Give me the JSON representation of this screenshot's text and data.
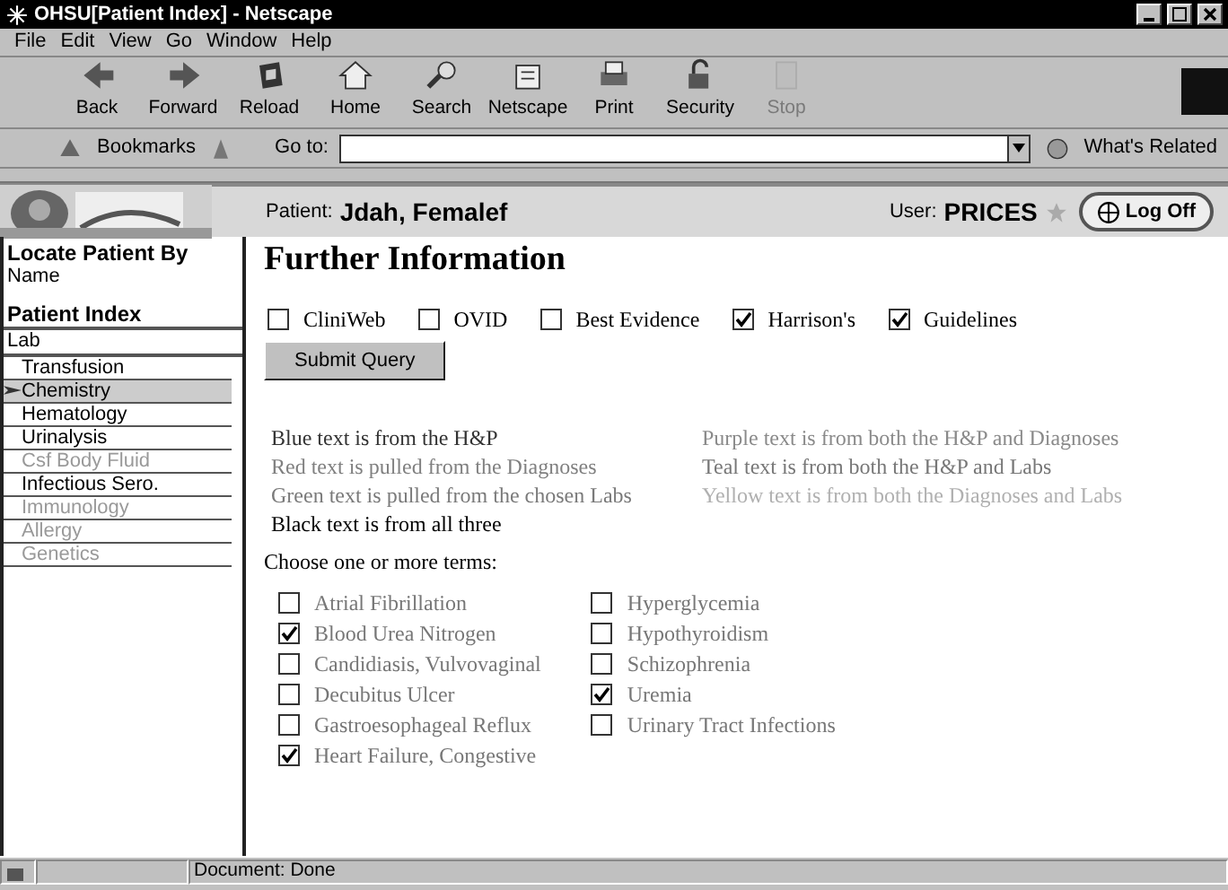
{
  "window": {
    "title": "OHSU[Patient Index] - Netscape"
  },
  "menu": [
    "File",
    "Edit",
    "View",
    "Go",
    "Window",
    "Help"
  ],
  "toolbar": [
    {
      "label": "Back",
      "disabled": false
    },
    {
      "label": "Forward",
      "disabled": false
    },
    {
      "label": "Reload",
      "disabled": false
    },
    {
      "label": "Home",
      "disabled": false
    },
    {
      "label": "Search",
      "disabled": false
    },
    {
      "label": "Netscape",
      "disabled": false
    },
    {
      "label": "Print",
      "disabled": false
    },
    {
      "label": "Security",
      "disabled": false
    },
    {
      "label": "Stop",
      "disabled": true
    }
  ],
  "location_bar": {
    "bookmarks": "Bookmarks",
    "goto_label": "Go to:",
    "related": "What's Related"
  },
  "header": {
    "patient_label": "Patient:",
    "patient_name": "Jdah, Femalef",
    "user_label": "User:",
    "user_name": "PRICES",
    "logoff": "Log Off"
  },
  "sidebar": {
    "locate_heading": "Locate Patient By",
    "locate_link": "Name",
    "index_heading": "Patient Index",
    "section": "Lab",
    "items": [
      {
        "label": "Transfusion",
        "selected": false,
        "disabled": false
      },
      {
        "label": "Chemistry",
        "selected": true,
        "disabled": false
      },
      {
        "label": "Hematology",
        "selected": false,
        "disabled": false
      },
      {
        "label": "Urinalysis",
        "selected": false,
        "disabled": false
      },
      {
        "label": "Csf Body Fluid",
        "selected": false,
        "disabled": true
      },
      {
        "label": "Infectious Sero.",
        "selected": false,
        "disabled": false
      },
      {
        "label": "Immunology",
        "selected": false,
        "disabled": true
      },
      {
        "label": "Allergy",
        "selected": false,
        "disabled": true
      },
      {
        "label": "Genetics",
        "selected": false,
        "disabled": true
      }
    ]
  },
  "content": {
    "title": "Further Information",
    "sources": [
      {
        "label": "CliniWeb",
        "checked": false
      },
      {
        "label": "OVID",
        "checked": false
      },
      {
        "label": "Best Evidence",
        "checked": false
      },
      {
        "label": "Harrison's",
        "checked": true
      },
      {
        "label": "Guidelines",
        "checked": true
      }
    ],
    "submit": "Submit Query",
    "legend": [
      {
        "text": "Blue text is from the H&P",
        "color": "#333333"
      },
      {
        "text": "Purple text is from both the H&P and Diagnoses",
        "color": "#8a8a8a"
      },
      {
        "text": "Red text is pulled from the Diagnoses",
        "color": "#808080"
      },
      {
        "text": "Teal text is from both the H&P and Labs",
        "color": "#777777"
      },
      {
        "text": "Green text is pulled from the chosen Labs",
        "color": "#7a7a7a"
      },
      {
        "text": "Yellow text is from both the Diagnoses and Labs",
        "color": "#b0b0b0"
      },
      {
        "text": "Black text is from all three",
        "color": "#000000"
      }
    ],
    "terms_prompt": "Choose one or more terms:",
    "terms": [
      [
        {
          "label": "Atrial Fibrillation",
          "checked": false
        },
        {
          "label": "Blood Urea Nitrogen",
          "checked": true
        },
        {
          "label": "Candidiasis, Vulvovaginal",
          "checked": false
        },
        {
          "label": "Decubitus Ulcer",
          "checked": false
        },
        {
          "label": "Gastroesophageal Reflux",
          "checked": false
        },
        {
          "label": "Heart Failure, Congestive",
          "checked": true
        }
      ],
      [
        {
          "label": "Hyperglycemia",
          "checked": false
        },
        {
          "label": "Hypothyroidism",
          "checked": false
        },
        {
          "label": "Schizophrenia",
          "checked": false
        },
        {
          "label": "Uremia",
          "checked": true
        },
        {
          "label": "Urinary Tract Infections",
          "checked": false
        }
      ]
    ]
  },
  "status_bar": "Document: Done"
}
